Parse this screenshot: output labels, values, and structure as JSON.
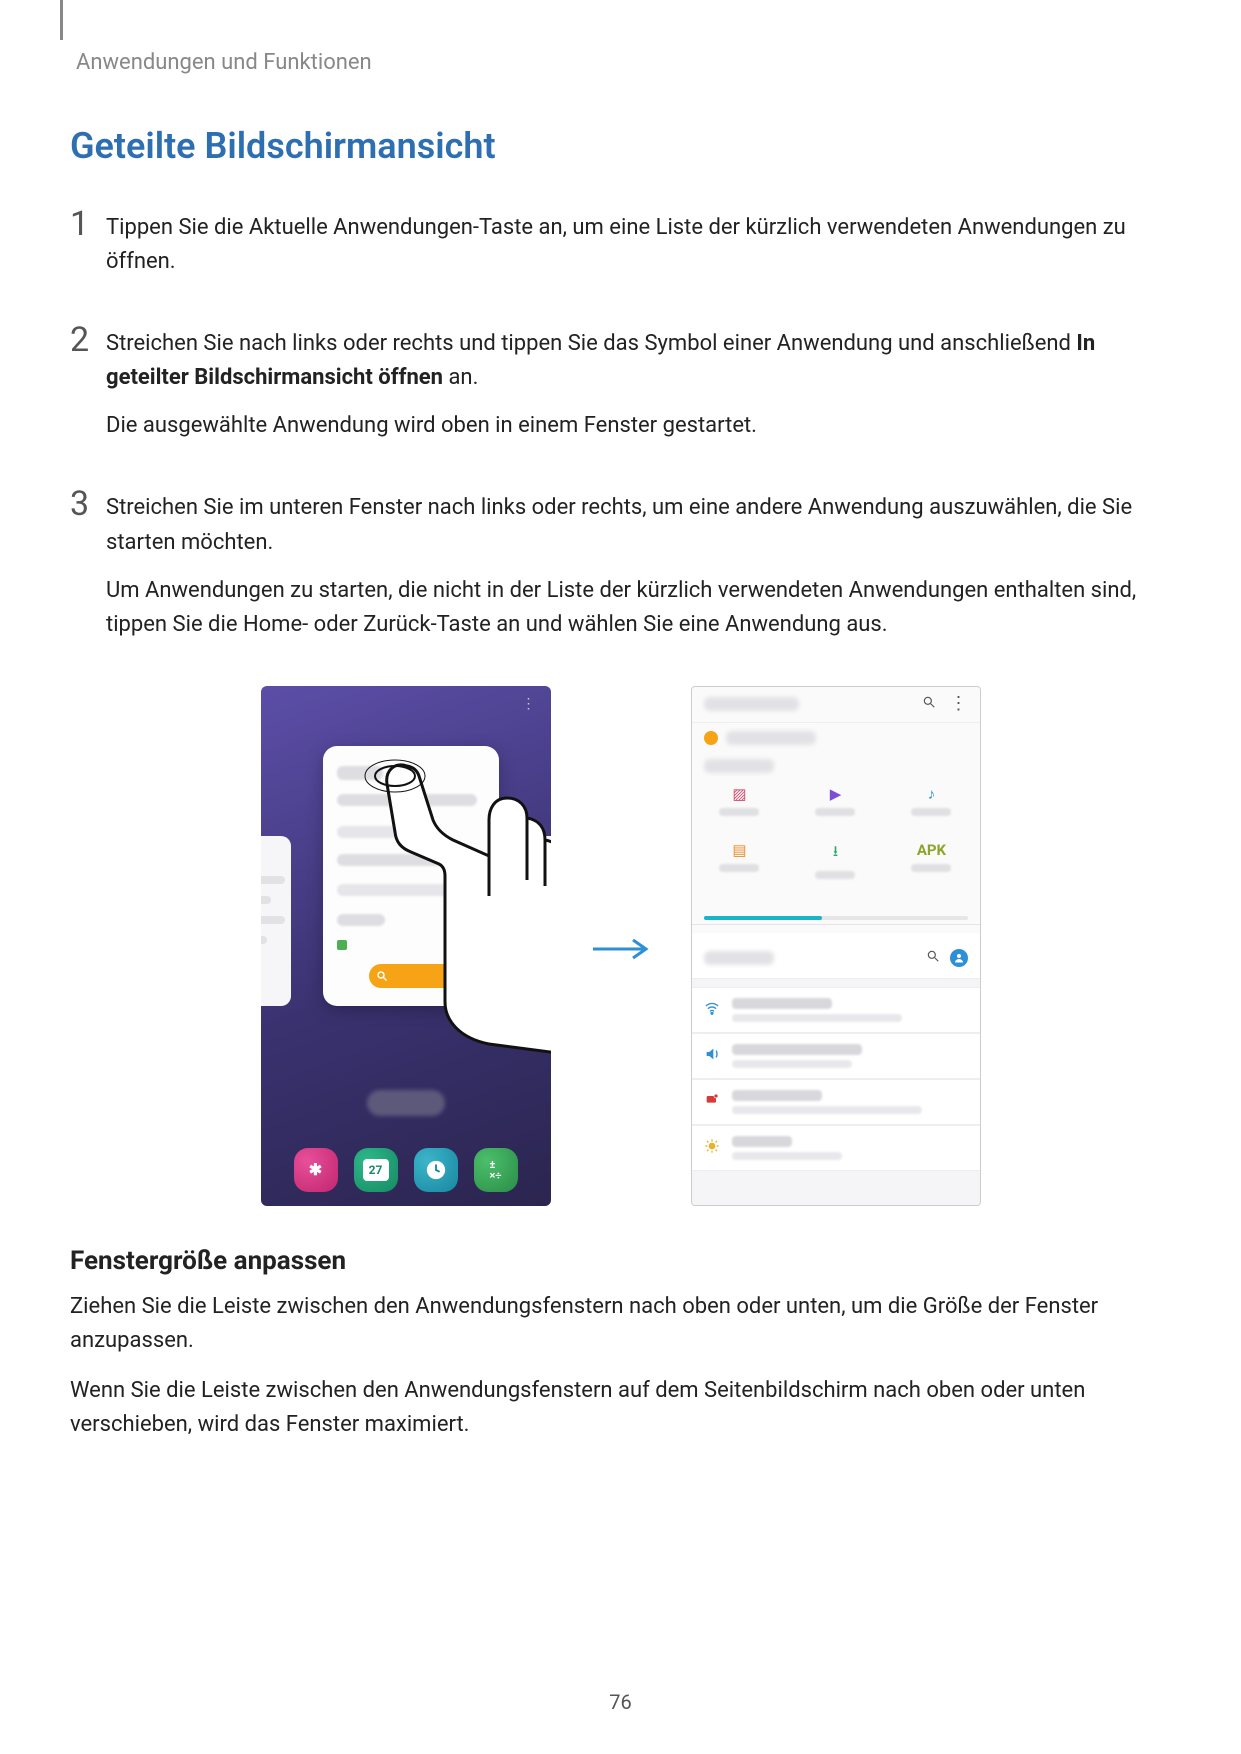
{
  "breadcrumb": "Anwendungen und Funktionen",
  "section_title": "Geteilte Bildschirmansicht",
  "steps": {
    "s1": {
      "num": "1",
      "text": "Tippen Sie die Aktuelle Anwendungen-Taste an, um eine Liste der kürzlich verwendeten Anwendungen zu öffnen."
    },
    "s2": {
      "num": "2",
      "text_before": "Streichen Sie nach links oder rechts und tippen Sie das Symbol einer Anwendung und anschließend ",
      "bold": "In geteilter Bildschirmansicht öffnen",
      "text_after": " an.",
      "followup": "Die ausgewählte Anwendung wird oben in einem Fenster gestartet."
    },
    "s3": {
      "num": "3",
      "text": "Streichen Sie im unteren Fenster nach links oder rechts, um eine andere Anwendung auszuwählen, die Sie starten möchten.",
      "followup": "Um Anwendungen zu starten, die nicht in der Liste der kürzlich verwendeten Anwendungen enthalten sind, tippen Sie die Home- oder Zurück-Taste an und wählen Sie eine Anwendung aus."
    }
  },
  "left_phone": {
    "calendar_day": "27",
    "calc_glyphs": "±\n×÷"
  },
  "right_phone": {
    "apk_label": "APK"
  },
  "arrow_glyph": "→",
  "subsection_title": "Fenstergröße anpassen",
  "para1": "Ziehen Sie die Leiste zwischen den Anwendungsfenstern nach oben oder unten, um die Größe der Fenster anzupassen.",
  "para2": "Wenn Sie die Leiste zwischen den Anwendungsfenstern auf dem Seitenbildschirm nach oben oder unten verschieben, wird das Fenster maximiert.",
  "page_number": "76"
}
